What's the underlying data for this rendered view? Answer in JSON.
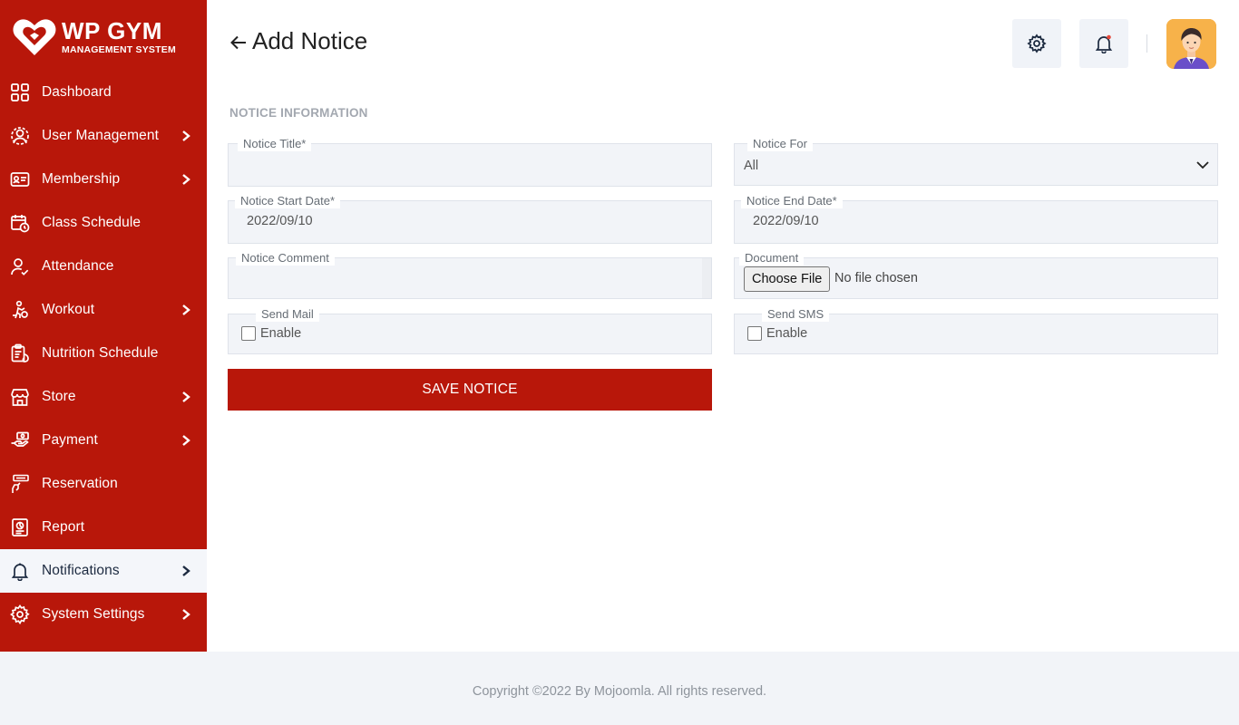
{
  "brand": {
    "name": "WP GYM",
    "subtitle": "MANAGEMENT SYSTEM",
    "color": "#b8170a"
  },
  "sidebar": {
    "items": [
      {
        "label": "Dashboard",
        "icon": "dashboard-icon",
        "has_submenu": false
      },
      {
        "label": "User Management",
        "icon": "users-icon",
        "has_submenu": true
      },
      {
        "label": "Membership",
        "icon": "membership-card-icon",
        "has_submenu": true
      },
      {
        "label": "Class Schedule",
        "icon": "calendar-icon",
        "has_submenu": false
      },
      {
        "label": "Attendance",
        "icon": "user-check-icon",
        "has_submenu": false
      },
      {
        "label": "Workout",
        "icon": "workout-icon",
        "has_submenu": true
      },
      {
        "label": "Nutrition Schedule",
        "icon": "clipboard-icon",
        "has_submenu": false
      },
      {
        "label": "Store",
        "icon": "store-icon",
        "has_submenu": true
      },
      {
        "label": "Payment",
        "icon": "payment-hand-icon",
        "has_submenu": true
      },
      {
        "label": "Reservation",
        "icon": "booking-icon",
        "has_submenu": false
      },
      {
        "label": "Report",
        "icon": "report-icon",
        "has_submenu": false
      },
      {
        "label": "Notifications",
        "icon": "bell-icon",
        "has_submenu": true,
        "active": true
      },
      {
        "label": "System Settings",
        "icon": "gear-icon",
        "has_submenu": true
      }
    ]
  },
  "header": {
    "title": "Add Notice",
    "settings_icon": "gear-icon",
    "notification_icon": "bell-icon",
    "has_unread": true
  },
  "form": {
    "section_title": "NOTICE INFORMATION",
    "notice_title": {
      "label": "Notice Title*",
      "value": ""
    },
    "notice_for": {
      "label": "Notice For",
      "value": "All"
    },
    "start_date": {
      "label": "Notice Start Date*",
      "value": "2022/09/10"
    },
    "end_date": {
      "label": "Notice End Date*",
      "value": "2022/09/10"
    },
    "comment": {
      "label": "Notice Comment",
      "value": ""
    },
    "document": {
      "label": "Document",
      "button": "Choose File",
      "status": "No file chosen"
    },
    "send_mail": {
      "label": "Send Mail",
      "checkbox_label": "Enable",
      "checked": false
    },
    "send_sms": {
      "label": "Send SMS",
      "checkbox_label": "Enable",
      "checked": false
    },
    "save_button": "SAVE NOTICE"
  },
  "footer": {
    "text": "Copyright ©2022 By Mojoomla. All rights reserved."
  }
}
